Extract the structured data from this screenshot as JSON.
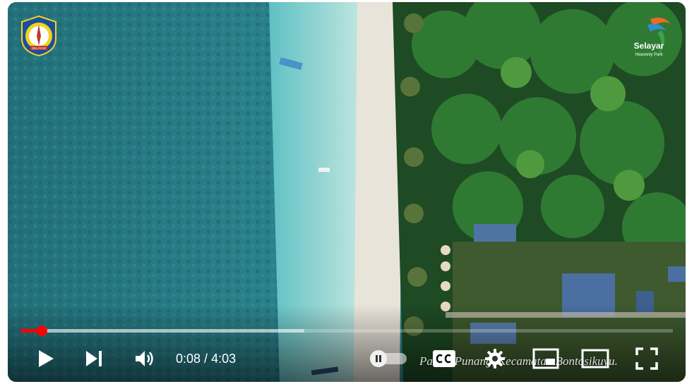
{
  "video": {
    "caption": "Pantai Punang, Kecamatan Bontosikuyu.",
    "brand_logo_text": "Selayar",
    "brand_logo_subtext": "Heavenly Park",
    "regency_logo_text": "SELAYAR"
  },
  "player": {
    "current_time": "0:08",
    "separator": " / ",
    "duration": "4:03",
    "progress_fraction": 0.033,
    "buffered_fraction": 0.435,
    "autoplay": "off",
    "accent_color": "#ff0000"
  },
  "icons": {
    "play": "play-icon",
    "next": "skip-next-icon",
    "volume": "volume-icon",
    "autoplay": "autoplay-toggle",
    "captions": "cc-icon",
    "settings": "gear-icon",
    "miniplayer": "miniplayer-icon",
    "theater": "theater-mode-icon",
    "fullscreen": "fullscreen-icon"
  }
}
